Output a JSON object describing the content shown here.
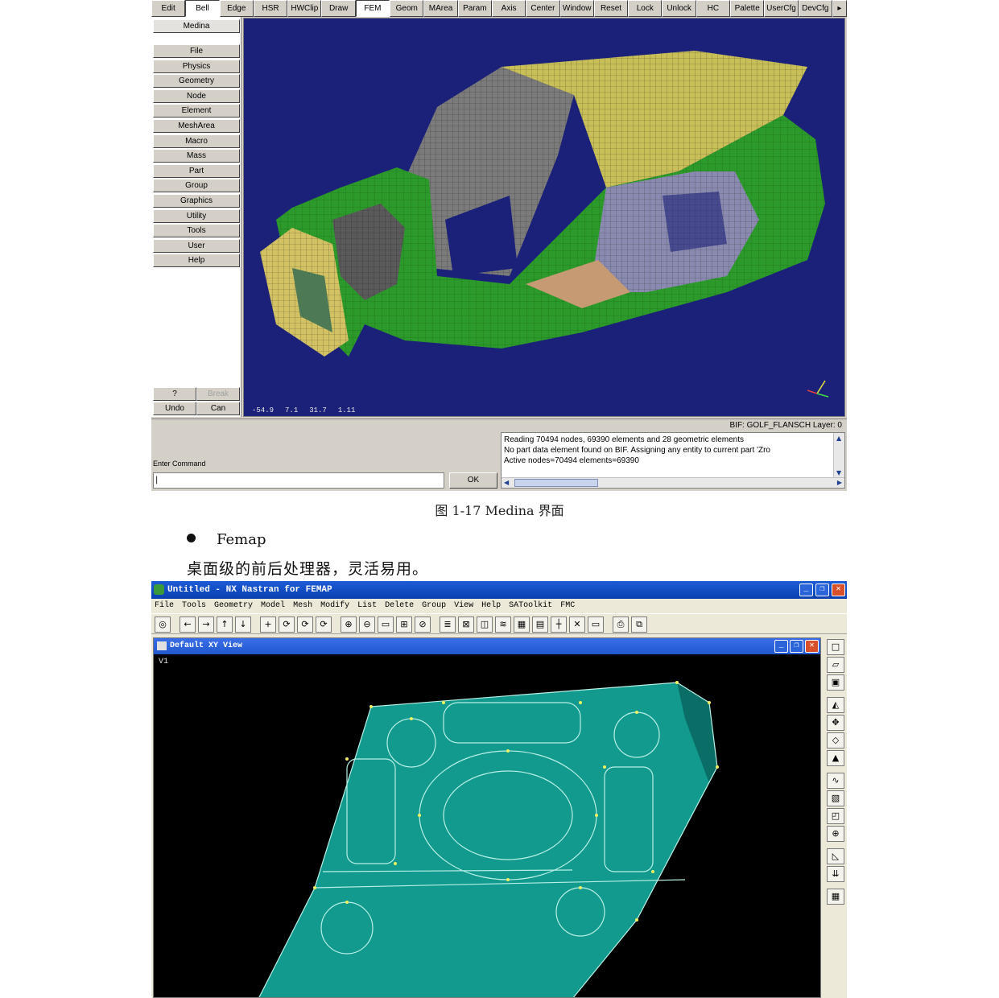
{
  "medina": {
    "toolbar": [
      "Edit",
      "Bell",
      "Edge",
      "HSR",
      "HWClip",
      "Draw",
      "FEM",
      "Geom",
      "MArea",
      "Param",
      "Axis",
      "Center",
      "Window",
      "Reset",
      "Lock",
      "Unlock",
      "HC",
      "Palette",
      "UserCfg",
      "DevCfg"
    ],
    "toolbar_selected": [
      "Bell",
      "FEM"
    ],
    "toolbar_more": "▸",
    "sidebar_header": "Medina",
    "sidebar": [
      "File",
      "Physics",
      "Geometry",
      "Node",
      "Element",
      "MeshArea",
      "Macro",
      "Mass",
      "Part",
      "Group",
      "Graphics",
      "Utility",
      "Tools",
      "User",
      "Help"
    ],
    "small_buttons": {
      "help": "?",
      "break": "Break",
      "undo": "Undo",
      "can": "Can"
    },
    "coords": [
      "-54.9",
      "7.1",
      "31.7",
      "1.11"
    ],
    "status": "BIF: GOLF_FLANSCH   Layer: 0",
    "cmd_label": "Enter Command",
    "cmd_value": "|",
    "ok": "OK",
    "log": [
      "Reading 70494 nodes, 69390 elements and 28 geometric elements",
      "No part data element found on BIF. Assigning any entity to current part 'Zro",
      "Active nodes=70494 elements=69390"
    ],
    "colors": {
      "view_bg": "#1b2178",
      "panel": "#d4d0c8",
      "car_green": "#2c9a2a",
      "roof_yellow": "#c9bf58",
      "roof_gray": "#7a7a7a"
    }
  },
  "caption": "图 1-17 Medina 界面",
  "bullet": "Femap",
  "body": "桌面级的前后处理器，灵活易用。",
  "femap": {
    "title": "Untitled - NX Nastran for FEMAP",
    "menu": [
      "File",
      "Tools",
      "Geometry",
      "Model",
      "Mesh",
      "Modify",
      "List",
      "Delete",
      "Group",
      "View",
      "Help",
      "SAToolkit",
      "FMC"
    ],
    "subwindow_title": "Default XY View",
    "view_label": "V1",
    "toolbar_icons": [
      "femap-logo-icon",
      "arrow-left-icon",
      "arrow-right-icon",
      "arrow-up-icon",
      "arrow-down-icon",
      "plus-icon",
      "rotate-x-icon",
      "rotate-y-icon",
      "rotate-z-icon",
      "zoom-in-icon",
      "zoom-out-icon",
      "window-select-icon",
      "fit-icon",
      "snap-icon",
      "list-icon",
      "box-icon",
      "cube-icon",
      "layers-icon",
      "grid-icon",
      "table-icon",
      "cross-icon",
      "close-x-icon",
      "window-icon",
      "print-icon",
      "copy-icon"
    ],
    "right_icons": [
      "new-icon",
      "open-icon",
      "save-icon",
      "mesh-icon",
      "node-icon",
      "elem-icon",
      "load-icon",
      "curve-icon",
      "surface-icon",
      "solid-icon",
      "constraint-icon",
      "force-icon",
      "arrows-icon",
      "table-icon"
    ],
    "colors": {
      "part_cyan": "#129a8e",
      "edge_yellow": "#f0f060",
      "bg": "#000000"
    }
  }
}
